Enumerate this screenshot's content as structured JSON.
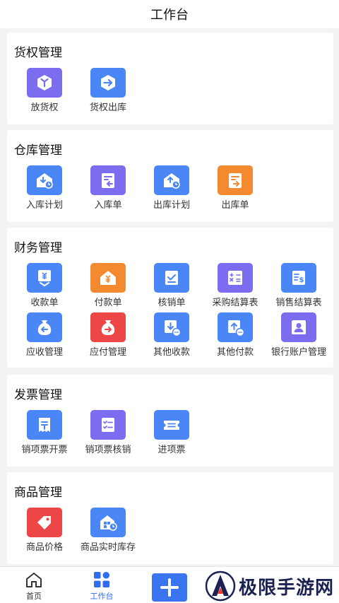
{
  "header": {
    "title": "工作台"
  },
  "sections": [
    {
      "title": "货权管理",
      "items": [
        {
          "label": "放货权",
          "icon": "cube-icon",
          "color": "#7b6cf0"
        },
        {
          "label": "货权出库",
          "icon": "arrow-hexagon-icon",
          "color": "#4a86f5"
        }
      ]
    },
    {
      "title": "仓库管理",
      "items": [
        {
          "label": "入库计划",
          "icon": "warehouse-in-clock-icon",
          "color": "#4a86f5"
        },
        {
          "label": "入库单",
          "icon": "document-in-icon",
          "color": "#7b6cf0"
        },
        {
          "label": "出库计划",
          "icon": "warehouse-out-clock-icon",
          "color": "#4a86f5"
        },
        {
          "label": "出库单",
          "icon": "document-out-icon",
          "color": "#f48a2f"
        }
      ]
    },
    {
      "title": "财务管理",
      "items": [
        {
          "label": "收款单",
          "icon": "yen-receive-icon",
          "color": "#4a86f5"
        },
        {
          "label": "付款单",
          "icon": "yen-house-icon",
          "color": "#f48a2f"
        },
        {
          "label": "核销单",
          "icon": "check-box-icon",
          "color": "#4a86f5"
        },
        {
          "label": "采购结算表",
          "icon": "calculator-icon",
          "color": "#7b6cf0"
        },
        {
          "label": "销售结算表",
          "icon": "dollar-sheet-icon",
          "color": "#4a86f5"
        },
        {
          "label": "应收管理",
          "icon": "money-bag-in-icon",
          "color": "#4a86f5"
        },
        {
          "label": "应付管理",
          "icon": "money-bag-out-icon",
          "color": "#ec4646"
        },
        {
          "label": "其他收款",
          "icon": "download-chat-icon",
          "color": "#4a86f5"
        },
        {
          "label": "其他付款",
          "icon": "upload-chat-icon",
          "color": "#4a86f5"
        },
        {
          "label": "银行账户管理",
          "icon": "bank-account-icon",
          "color": "#7b6cf0"
        }
      ]
    },
    {
      "title": "发票管理",
      "items": [
        {
          "label": "销项票开票",
          "icon": "receipt-icon",
          "color": "#4a86f5"
        },
        {
          "label": "销项票核销",
          "icon": "checklist-icon",
          "color": "#7b6cf0"
        },
        {
          "label": "进项票",
          "icon": "ticket-icon",
          "color": "#4a86f5"
        }
      ]
    },
    {
      "title": "商品管理",
      "items": [
        {
          "label": "商品价格",
          "icon": "price-tag-icon",
          "color": "#ec4646"
        },
        {
          "label": "商品实时库存",
          "icon": "inventory-clock-icon",
          "color": "#4a86f5"
        }
      ]
    }
  ],
  "tabbar": {
    "home": "首页",
    "workbench": "工作台"
  },
  "watermark": {
    "text": "极限手游网"
  }
}
